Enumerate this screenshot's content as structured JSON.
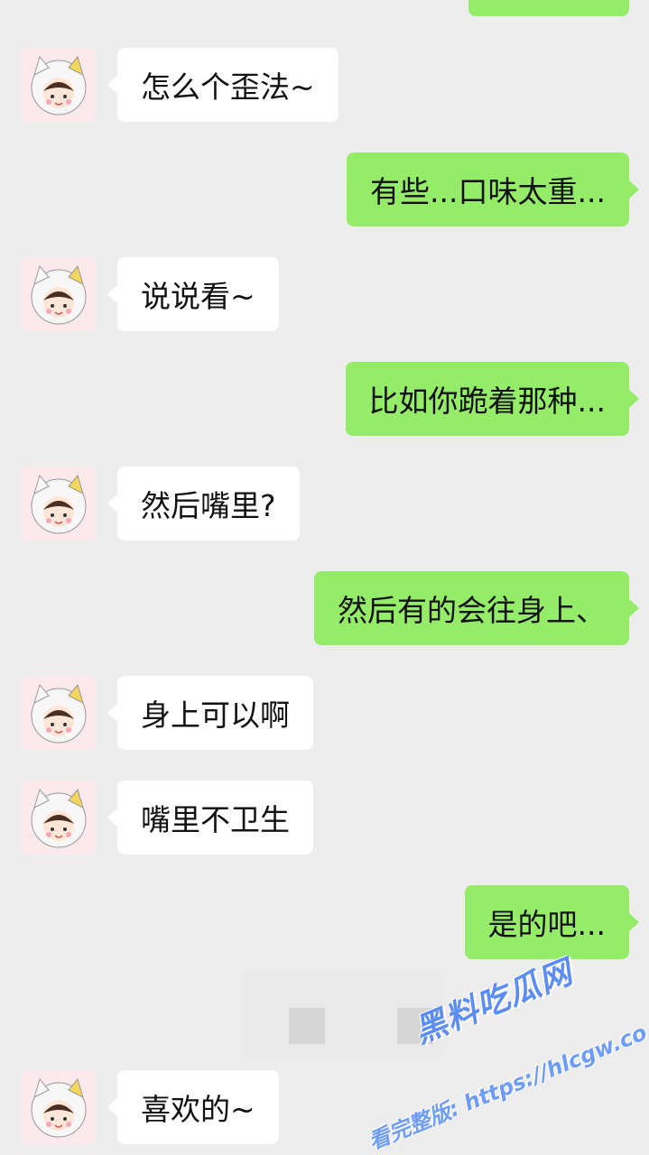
{
  "messages": [
    {
      "side": "in",
      "text": "怎么个歪法~"
    },
    {
      "side": "out",
      "text": "有些...口味太重..."
    },
    {
      "side": "in",
      "text": "说说看~"
    },
    {
      "side": "out",
      "text": "比如你跪着那种..."
    },
    {
      "side": "in",
      "text": "然后嘴里?"
    },
    {
      "side": "out",
      "text": "然后有的会往身上、"
    },
    {
      "side": "in",
      "text": "身上可以啊"
    },
    {
      "side": "in",
      "text": "嘴里不卫生"
    },
    {
      "side": "out",
      "text": "是的吧..."
    },
    {
      "side": "in",
      "text": "喜欢的~"
    }
  ],
  "watermark": {
    "title": "黑料吃瓜网",
    "subtitle": "看完整版: https://hlcgw.co"
  },
  "colors": {
    "background": "#ededed",
    "incoming_bubble": "#ffffff",
    "outgoing_bubble": "#95ec69",
    "watermark": "#5b8df5"
  },
  "icons": {
    "contact_avatar": "cartoon-cat-hood-avatar"
  }
}
